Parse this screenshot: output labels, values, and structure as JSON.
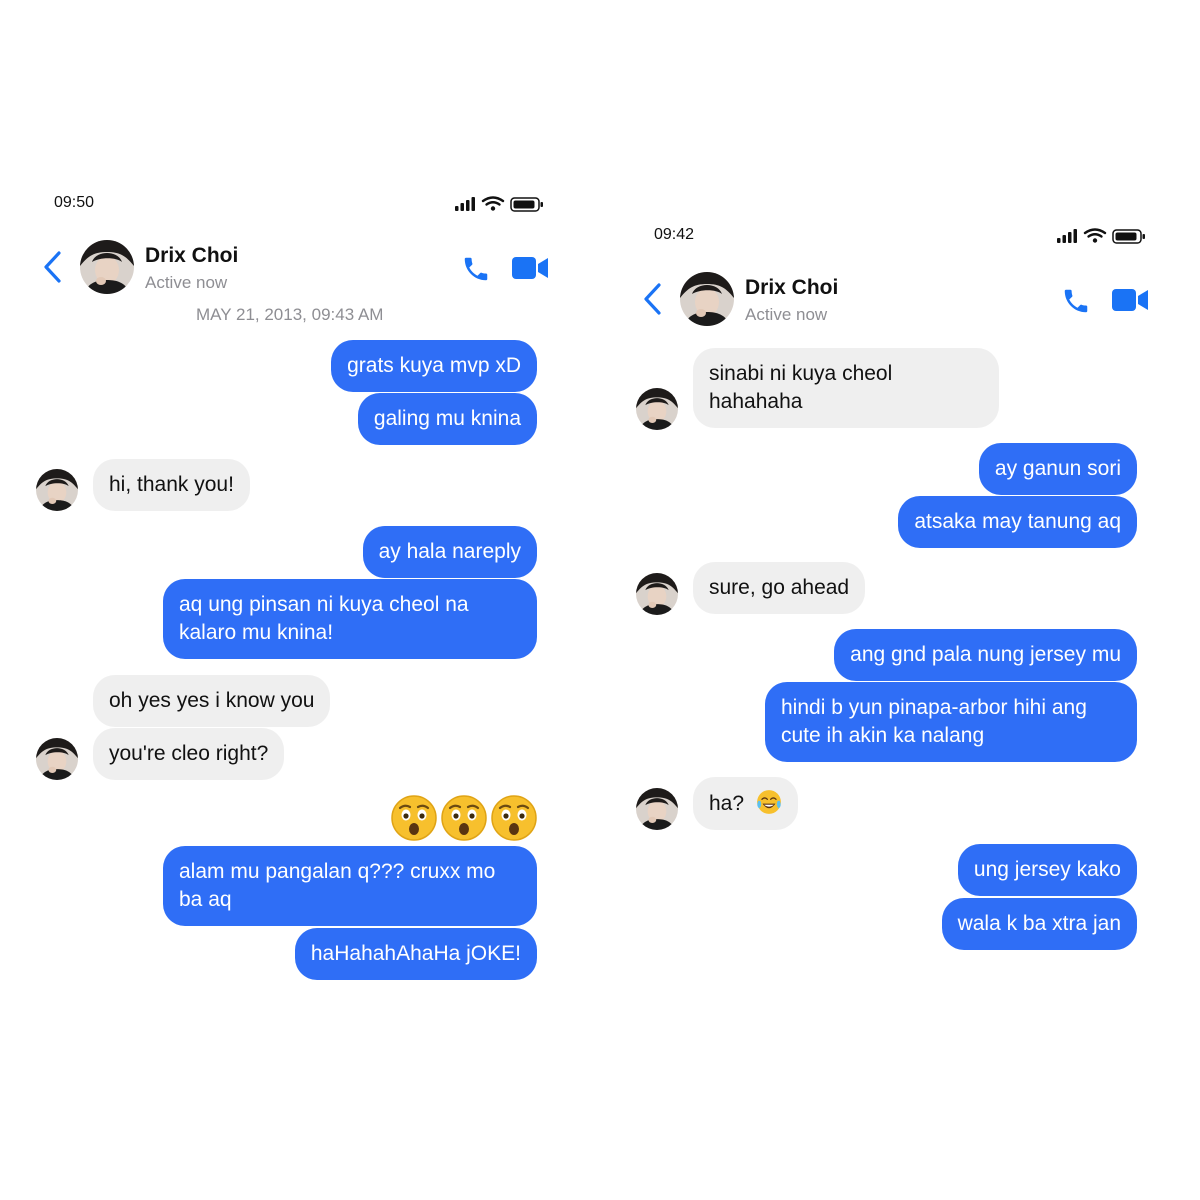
{
  "screens": [
    {
      "status_time": "09:50",
      "contact": {
        "name": "Drix Choi",
        "status": "Active now"
      },
      "date_stamp": "MAY 21, 2013, 09:43 AM",
      "messages": [
        {
          "from": "me",
          "text": "grats kuya mvp xD"
        },
        {
          "from": "me",
          "text": "galing mu knina"
        },
        {
          "from": "contact",
          "text": "hi, thank you!"
        },
        {
          "from": "me",
          "text": "ay hala nareply"
        },
        {
          "from": "me",
          "text": "aq ung pinsan ni kuya cheol na kalaro mu knina!"
        },
        {
          "from": "contact",
          "text": "oh yes yes i know you"
        },
        {
          "from": "contact",
          "text": "you're cleo right?"
        },
        {
          "from": "me",
          "text": "alam mu pangalan q??? cruxx mo ba aq"
        },
        {
          "from": "me",
          "text": "haHahahAhaHa jOKE!"
        }
      ],
      "reaction_emoji": [
        "astonished-face-emoji",
        "astonished-face-emoji",
        "astonished-face-emoji"
      ]
    },
    {
      "status_time": "09:42",
      "contact": {
        "name": "Drix Choi",
        "status": "Active now"
      },
      "messages": [
        {
          "from": "contact",
          "text": "sinabi ni kuya cheol hahahaha"
        },
        {
          "from": "me",
          "text": "ay ganun sori"
        },
        {
          "from": "me",
          "text": "atsaka may tanung aq"
        },
        {
          "from": "contact",
          "text": "sure, go ahead"
        },
        {
          "from": "me",
          "text": "ang gnd pala nung jersey mu"
        },
        {
          "from": "me",
          "text": "hindi b yun pinapa-arbor hihi ang cute ih akin ka nalang"
        },
        {
          "from": "contact",
          "text": "ha?",
          "emoji": "tears-of-joy-emoji"
        },
        {
          "from": "me",
          "text": "ung jersey kako"
        },
        {
          "from": "me",
          "text": "wala k ba xtra jan"
        }
      ]
    }
  ],
  "icons": [
    "back-chevron-icon",
    "phone-icon",
    "video-camera-icon",
    "signal-icon",
    "wifi-icon",
    "battery-icon"
  ],
  "colors": {
    "outgoing_bubble": "#2f6ef6",
    "incoming_bubble": "#efefef",
    "accent": "#1a73f5",
    "muted_text": "#8e8e93"
  }
}
